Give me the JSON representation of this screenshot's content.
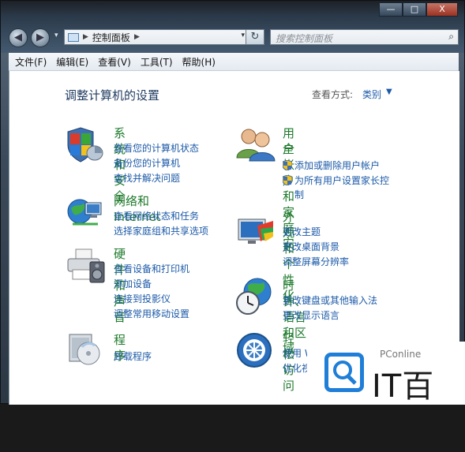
{
  "window": {
    "buttons": {
      "minimize": "—",
      "maximize": "□",
      "close": "X"
    }
  },
  "nav": {
    "back_icon": "◀",
    "forward_icon": "▶",
    "address_items": [
      "控制面板"
    ],
    "search_placeholder": "搜索控制面板"
  },
  "menu": [
    "文件(F)",
    "编辑(E)",
    "查看(V)",
    "工具(T)",
    "帮助(H)"
  ],
  "page": {
    "title": "调整计算机的设置",
    "view_by_label": "查看方式:",
    "view_by_value": "类别"
  },
  "categories": {
    "system": {
      "title": "系统和安全",
      "links": [
        "查看您的计算机状态",
        "备份您的计算机",
        "查找并解决问题"
      ]
    },
    "network": {
      "title": "网络和 Internet",
      "links": [
        "查看网络状态和任务",
        "选择家庭组和共享选项"
      ]
    },
    "hardware": {
      "title": "硬件和声音",
      "links": [
        "查看设备和打印机",
        "添加设备",
        "连接到投影仪",
        "调整常用移动设置"
      ]
    },
    "programs": {
      "title": "程序",
      "links": [
        "卸载程序"
      ]
    },
    "users": {
      "title_line1": "用户帐户和家庭安",
      "title_line2": "全",
      "links": [
        "添加或删除用户帐户",
        "为所有用户设置家长控",
        "制"
      ]
    },
    "appearance": {
      "title": "外观和个性化",
      "links": [
        "更改主题",
        "更改桌面背景",
        "调整屏幕分辨率"
      ]
    },
    "clock": {
      "title": "时钟、语言和区域",
      "links": [
        "更改键盘或其他输入法",
        "更改显示语言"
      ]
    },
    "ease": {
      "title": "轻松访问",
      "links": [
        "使用 W",
        "优化视"
      ]
    }
  },
  "watermark": {
    "small": "PConline",
    "big": "IT百科"
  }
}
